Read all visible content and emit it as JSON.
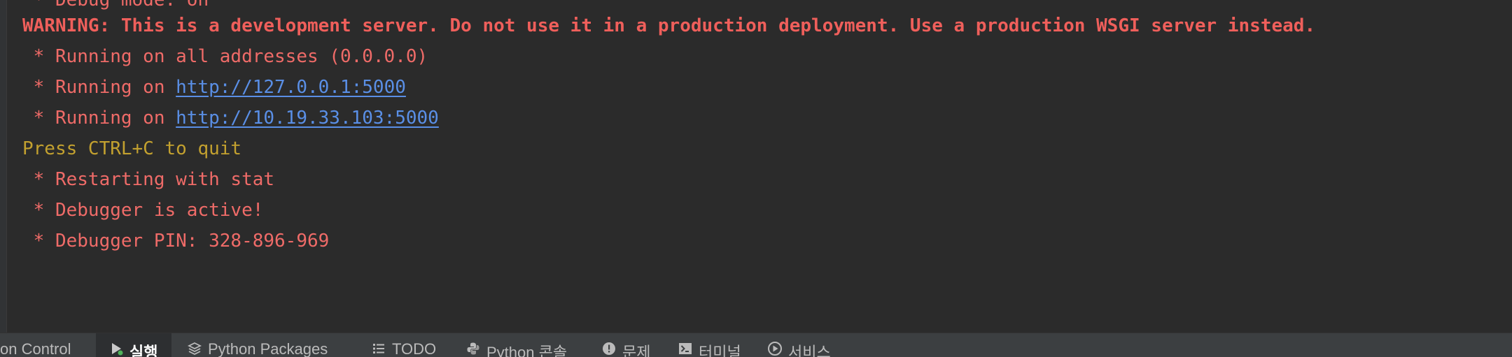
{
  "console": {
    "partial_top_line": " * Debug mode: on",
    "lines": [
      {
        "text": "WARNING: This is a development server. Do not use it in a production deployment. Use a production WSGI server instead."
      },
      {
        "text": " * Running on all addresses (0.0.0.0)"
      },
      {
        "prefix": " * Running on ",
        "link": "http://127.0.0.1:5000"
      },
      {
        "prefix": " * Running on ",
        "link": "http://10.19.33.103:5000"
      },
      {
        "text": "Press CTRL+C to quit"
      },
      {
        "text": " * Restarting with stat"
      },
      {
        "text": " * Debugger is active!"
      },
      {
        "text": " * Debugger PIN: 328-896-969"
      }
    ]
  },
  "toolwindow_bar": {
    "tabs": [
      {
        "label": "on Control",
        "icon": "none"
      },
      {
        "label": "실행",
        "icon": "run-icon",
        "active": true
      },
      {
        "label": "Python Packages",
        "icon": "layers-icon"
      },
      {
        "label": "TODO",
        "icon": "list-icon"
      },
      {
        "label": "Python 콘솔",
        "icon": "python-icon"
      },
      {
        "label": "문제",
        "icon": "problems-icon"
      },
      {
        "label": "터미널",
        "icon": "terminal-icon"
      },
      {
        "label": "서비스",
        "icon": "services-icon"
      }
    ]
  },
  "colors": {
    "background": "#2b2b2b",
    "stderr_red": "#ef6b68",
    "warning_red": "#ef5f5b",
    "quit_yellow": "#c3a12f",
    "link_blue": "#5a8fe6"
  }
}
